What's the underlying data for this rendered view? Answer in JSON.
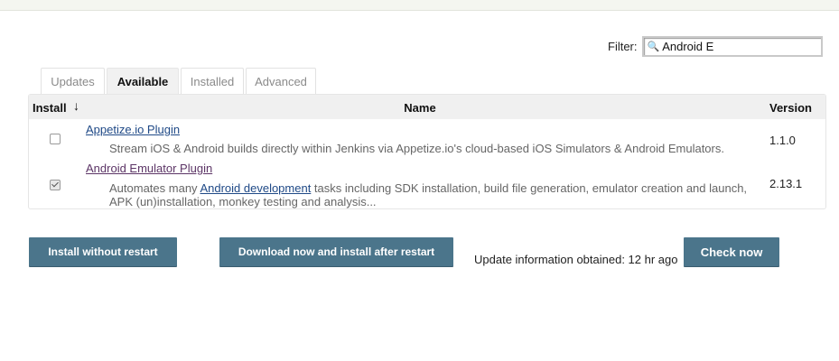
{
  "filter": {
    "label": "Filter:",
    "value": "Android E",
    "icon": "search-icon"
  },
  "tabs": [
    {
      "label": "Updates",
      "active": false
    },
    {
      "label": "Available",
      "active": true
    },
    {
      "label": "Installed",
      "active": false
    },
    {
      "label": "Advanced",
      "active": false
    }
  ],
  "table": {
    "headers": {
      "install": "Install",
      "sort_arrow": "↓",
      "name": "Name",
      "version": "Version"
    },
    "rows": [
      {
        "checked": false,
        "name": "Appetize.io Plugin",
        "description": "Stream iOS & Android builds directly within Jenkins via Appetize.io's cloud-based iOS Simulators & Android Emulators.",
        "version": "1.1.0"
      },
      {
        "checked": true,
        "name": "Android Emulator Plugin",
        "description_prefix": "Automates many ",
        "description_link": "Android development",
        "description_suffix": " tasks including SDK installation, build file generation, emulator creation and launch, APK (un)installation, monkey testing and analysis...",
        "version": "2.13.1"
      }
    ]
  },
  "actions": {
    "install_without_restart": "Install without restart",
    "download_install_after_restart": "Download now and install after restart",
    "update_info": "Update information obtained: 12 hr ago",
    "check_now": "Check now"
  },
  "colors": {
    "button_bg": "#4b758b",
    "link": "#204a87",
    "visited_link": "#5c3566"
  }
}
